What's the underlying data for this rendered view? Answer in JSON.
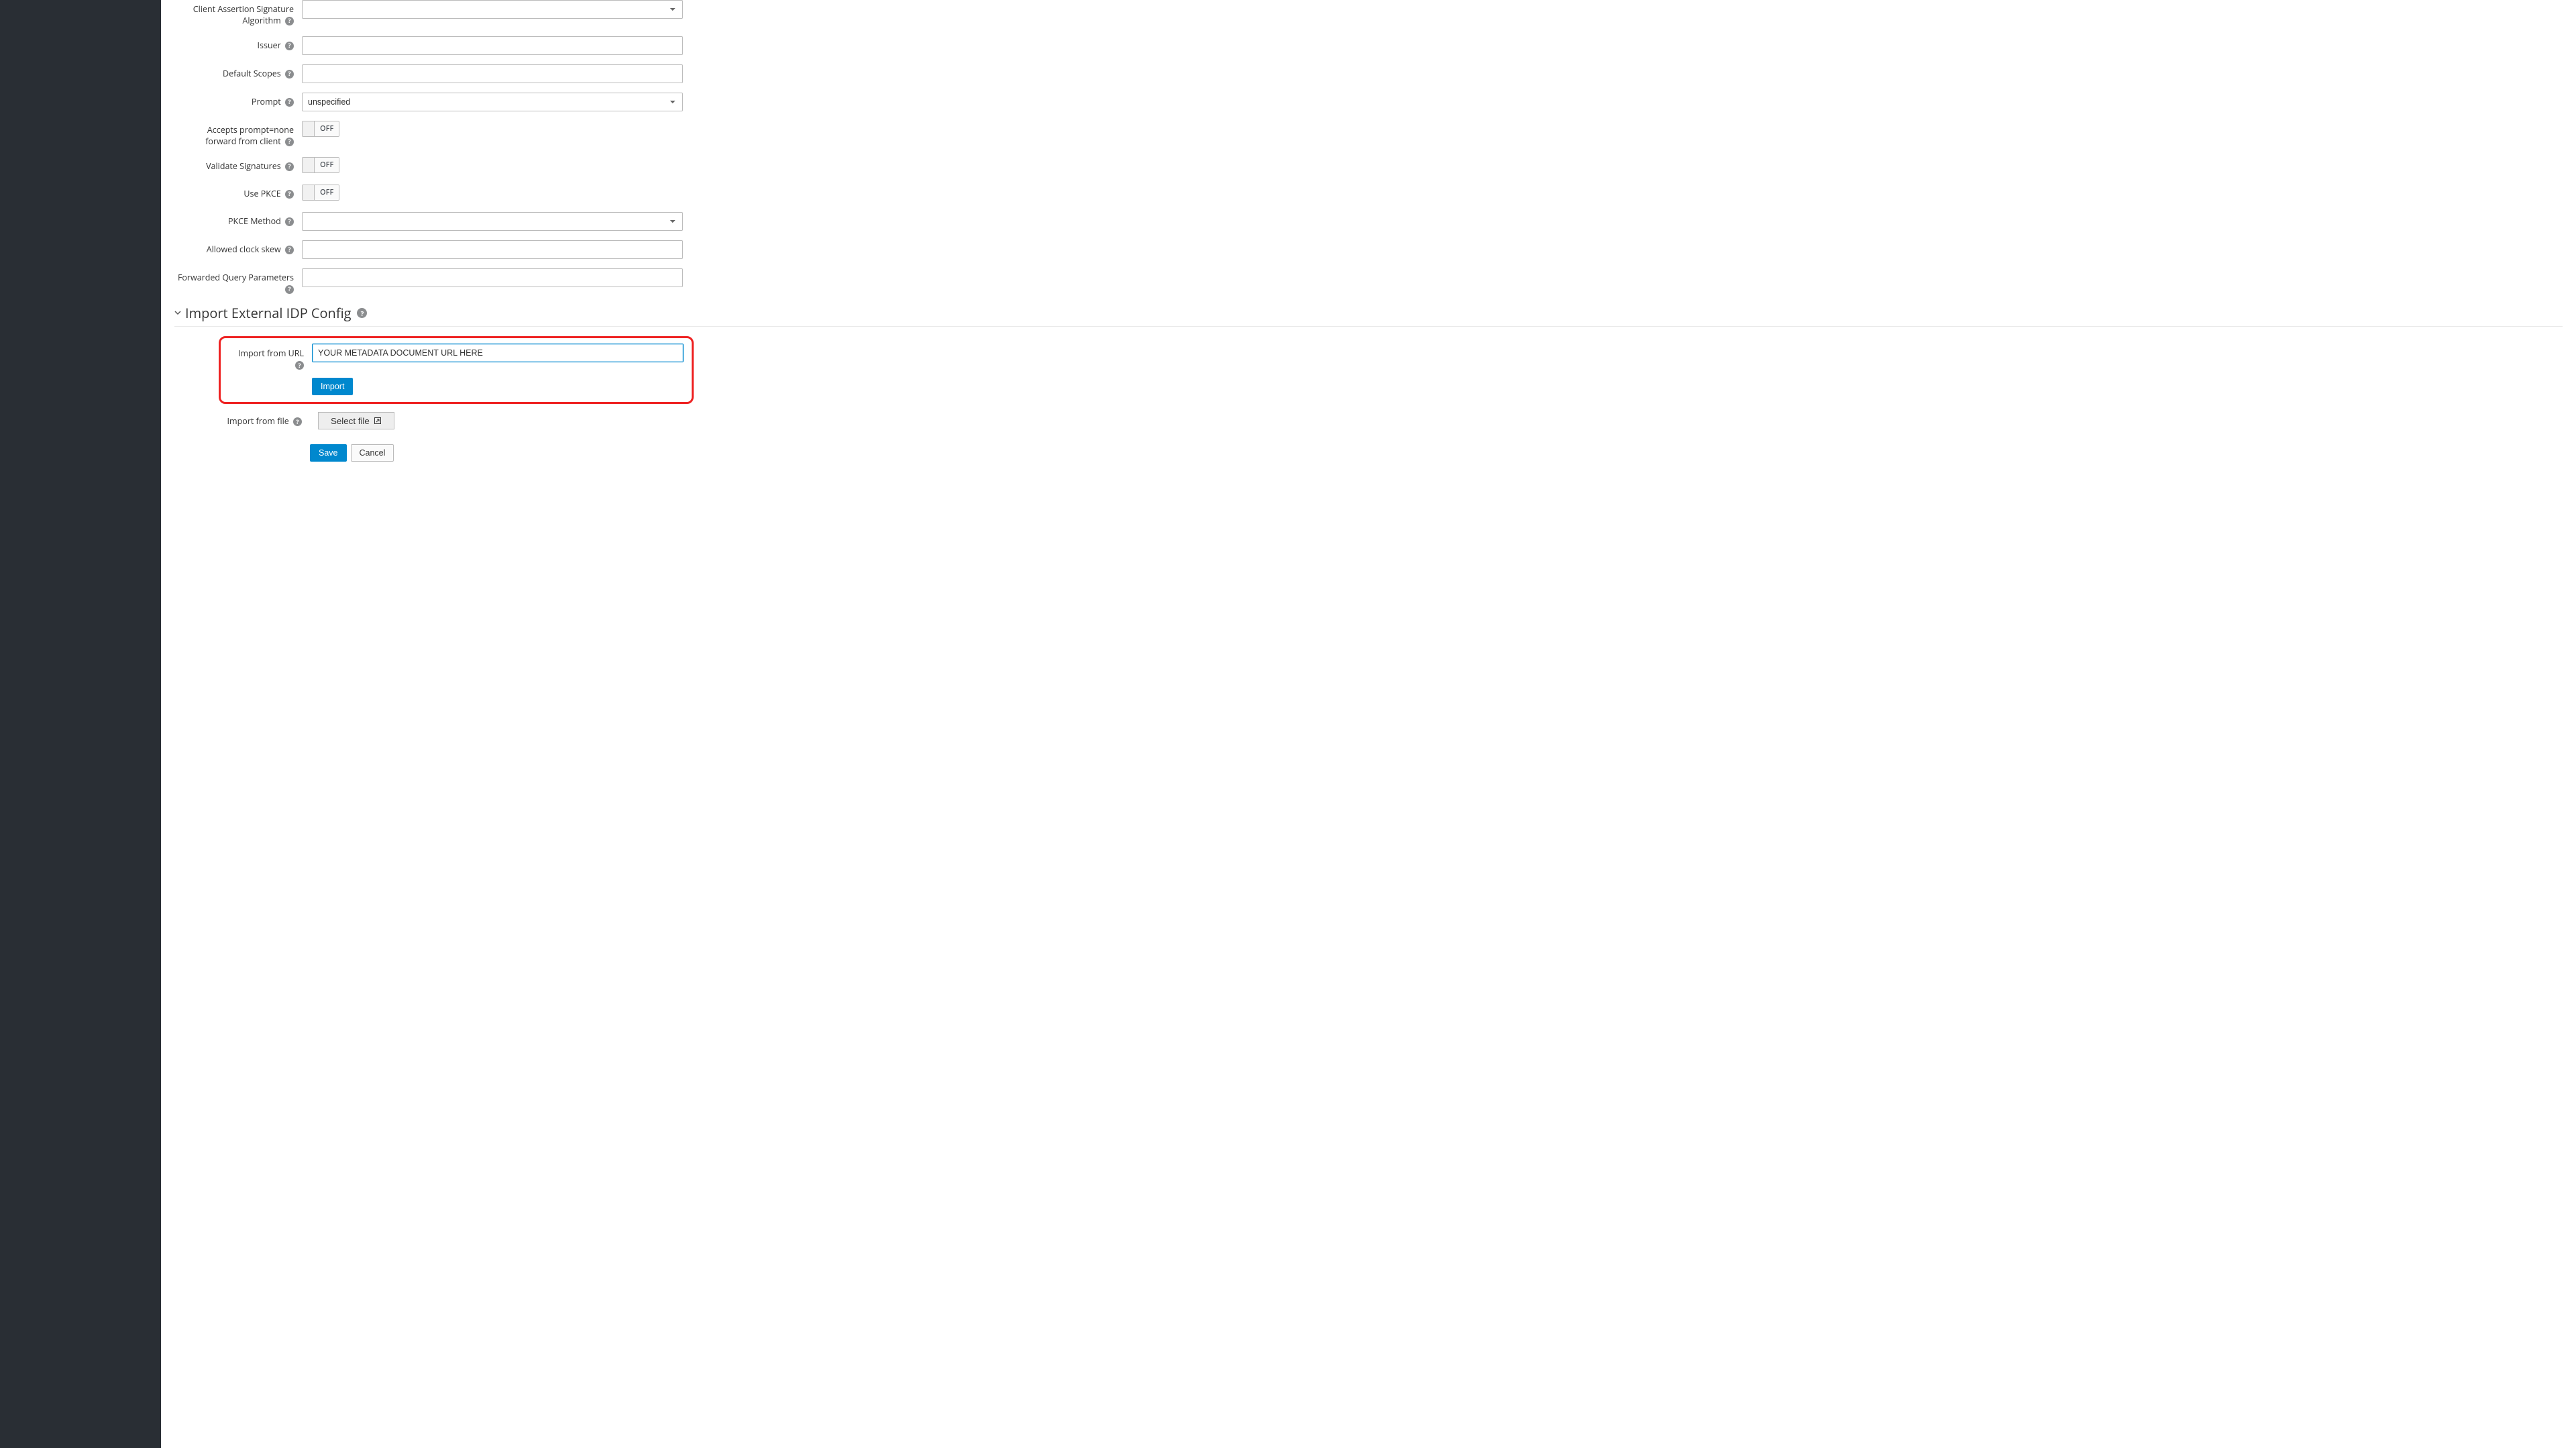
{
  "form": {
    "client_assertion_sig_alg": {
      "label": "Client Assertion Signature Algorithm",
      "value": ""
    },
    "issuer": {
      "label": "Issuer",
      "value": ""
    },
    "default_scopes": {
      "label": "Default Scopes",
      "value": ""
    },
    "prompt": {
      "label": "Prompt",
      "selected": "unspecified"
    },
    "accepts_prompt_none": {
      "label": "Accepts prompt=none forward from client",
      "state": "OFF"
    },
    "validate_signatures": {
      "label": "Validate Signatures",
      "state": "OFF"
    },
    "use_pkce": {
      "label": "Use PKCE",
      "state": "OFF"
    },
    "pkce_method": {
      "label": "PKCE Method",
      "value": ""
    },
    "allowed_clock_skew": {
      "label": "Allowed clock skew",
      "value": ""
    },
    "forwarded_query_params": {
      "label": "Forwarded Query Parameters",
      "value": ""
    }
  },
  "import_section": {
    "title": "Import External IDP Config",
    "from_url": {
      "label": "Import from URL",
      "value": "YOUR METADATA DOCUMENT URL HERE"
    },
    "import_button": "Import",
    "from_file": {
      "label": "Import from file",
      "button": "Select file"
    }
  },
  "actions": {
    "save": "Save",
    "cancel": "Cancel"
  },
  "help_glyph": "?"
}
